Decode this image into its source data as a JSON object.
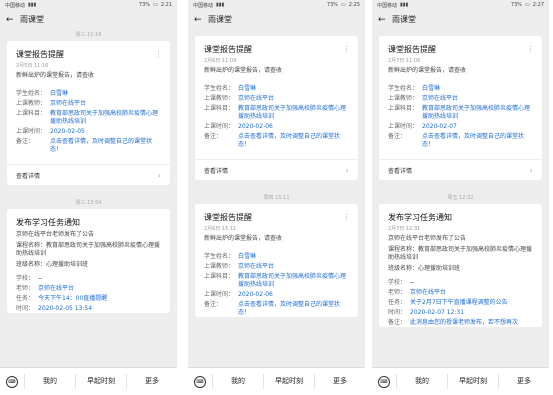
{
  "panels": [
    {
      "status": {
        "carrier": "中国移动",
        "time": "2:21",
        "battery": "73%"
      },
      "header": {
        "back_icon": "←",
        "title": "雨课堂"
      },
      "timestamp_top": "周三 11:16",
      "card1": {
        "title": "课堂报告提醒",
        "date": "2月5日 11:16",
        "desc": "新鲜出炉的课堂报告，请查收",
        "rows": [
          {
            "k": "学生姓名：",
            "v": "白雪琳"
          },
          {
            "k": "上课教师：",
            "v": "京师在线平台"
          },
          {
            "k": "上课科目：",
            "v": "教育部思政司关于加强高校肺炎疫情心理援助热线培训"
          },
          {
            "k": "上课时间：",
            "v": "2020-02-05"
          },
          {
            "k": "备注：",
            "v": "点击查看详情，及时调整自己的课堂状态！"
          }
        ],
        "footer": "查看详情"
      },
      "timestamp_mid": "周三 13:54",
      "card2": {
        "title": "发布学习任务通知",
        "desc": "京师在线平台老师发布了公告",
        "desc2": "课程名称：教育部思政司关于加强高校肺炎疫情心理援助热线培训",
        "desc3": "班级名称：心理援助培训班",
        "rows": [
          {
            "k": "学校：",
            "v": "--"
          },
          {
            "k": "老师：",
            "v": "京师在线平台"
          },
          {
            "k": "任务：",
            "v": "今天下午14：00直播提醒"
          },
          {
            "k": "时间：",
            "v": "2020-02-05 13:54"
          }
        ]
      },
      "bottom": {
        "tab1": "我的",
        "tab2": "早起时刻",
        "tab3": "更多"
      }
    },
    {
      "status": {
        "carrier": "中国移动",
        "time": "2:25",
        "battery": "73%"
      },
      "header": {
        "back_icon": "←",
        "title": "雨课堂"
      },
      "card1": {
        "title": "课堂报告提醒",
        "date": "2月6日 11:09",
        "desc": "新鲜出炉的课堂报告，请查收",
        "rows": [
          {
            "k": "学生姓名：",
            "v": "白雪琳"
          },
          {
            "k": "上课教师：",
            "v": "京师在线平台"
          },
          {
            "k": "上课科目：",
            "v": "教育部思政司关于加强高校肺炎疫情心理援助热线培训"
          },
          {
            "k": "上课时间：",
            "v": "2020-02-06"
          },
          {
            "k": "备注：",
            "v": "点击查看详情，及时调整自己的课堂状态！"
          }
        ],
        "footer": "查看详情"
      },
      "timestamp_mid": "周四 15:11",
      "card2": {
        "title": "课堂报告提醒",
        "date": "2月6日 15:11",
        "desc": "新鲜出炉的课堂报告，请查收",
        "rows": [
          {
            "k": "学生姓名：",
            "v": "白雪琳"
          },
          {
            "k": "上课教师：",
            "v": "京师在线平台"
          },
          {
            "k": "上课科目：",
            "v": "教育部思政司关于加强高校肺炎疫情心理援助热线培训"
          },
          {
            "k": "上课时间：",
            "v": "2020-02-06"
          },
          {
            "k": "备注：",
            "v": "点击查看详情，及时调整自己的课堂状态！"
          }
        ]
      },
      "bottom": {
        "tab1": "我的",
        "tab2": "早起时刻",
        "tab3": "更多"
      }
    },
    {
      "status": {
        "carrier": "中国移动",
        "time": "2:27",
        "battery": "73%"
      },
      "header": {
        "back_icon": "←",
        "title": "雨课堂"
      },
      "card1": {
        "title": "课堂报告提醒",
        "date": "2月7日 11:06",
        "desc": "新鲜出炉的课堂报告，请查收",
        "rows": [
          {
            "k": "学生姓名：",
            "v": "白雪琳"
          },
          {
            "k": "上课教师：",
            "v": "京师在线平台"
          },
          {
            "k": "上课科目：",
            "v": "教育部思政司关于加强高校肺炎疫情心理援助热线培训"
          },
          {
            "k": "上课时间：",
            "v": "2020-02-07"
          },
          {
            "k": "备注：",
            "v": "点击查看详情，及时调整自己的课堂状态！"
          }
        ],
        "footer": "查看详情"
      },
      "timestamp_mid": "周五 12:32",
      "card2": {
        "title": "发布学习任务通知",
        "date": "2月7日 12:31",
        "desc": "京师在线平台老师发布了公告",
        "desc2": "课程名称：教育部思政司关于加强高校肺炎疫情心理援助热线培训",
        "desc3": "班级名称：心理援助培训班",
        "rows": [
          {
            "k": "学校：",
            "v": "--"
          },
          {
            "k": "老师：",
            "v": "京师在线平台"
          },
          {
            "k": "任务：",
            "v": "关于2月7日下午直播课程调整的公告"
          },
          {
            "k": "时间：",
            "v": "2020-02-07 12:31"
          },
          {
            "k": "备注：",
            "v": "此消息由您的授课老师发布，若不想再次"
          }
        ]
      },
      "bottom": {
        "tab1": "我的",
        "tab2": "早起时刻",
        "tab3": "更多"
      }
    }
  ]
}
